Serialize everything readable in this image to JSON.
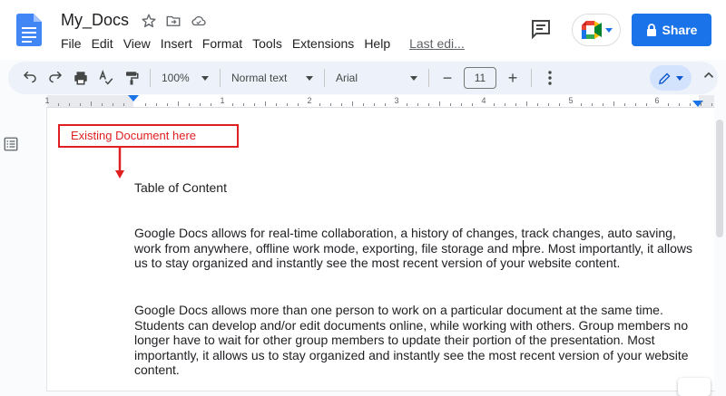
{
  "header": {
    "doc_title": "My_Docs",
    "menu": [
      "File",
      "Edit",
      "View",
      "Insert",
      "Format",
      "Tools",
      "Extensions",
      "Help"
    ],
    "last_edit": "Last edi...",
    "share_label": "Share"
  },
  "toolbar": {
    "zoom": "100%",
    "style": "Normal text",
    "font": "Arial",
    "font_size": "11",
    "minus": "−",
    "plus": "+"
  },
  "ruler": {
    "numbers": [
      "1",
      "1",
      "2",
      "3",
      "4",
      "5",
      "6"
    ]
  },
  "annotation": {
    "label": "Existing Document here",
    "color": "#e02020"
  },
  "document": {
    "heading": "Table of Content",
    "paragraph_1": "Google Docs allows for real-time collaboration, a history of changes, track changes, auto saving, work from anywhere, offline work mode, exporting, file storage and more. Most importantly, it allows us to stay organized and instantly see the most recent version of your website content.",
    "paragraph_2": "Google Docs allows more than one person to work on a particular document at the same time. Students can develop and/or edit documents online, while working with others. Group members no longer have to wait for other group members to update their portion of the presentation. Most importantly, it allows us to stay organized and instantly see the most recent version of your website content."
  },
  "colors": {
    "accent": "#1a73e8",
    "docs_blue": "#4285f4"
  }
}
